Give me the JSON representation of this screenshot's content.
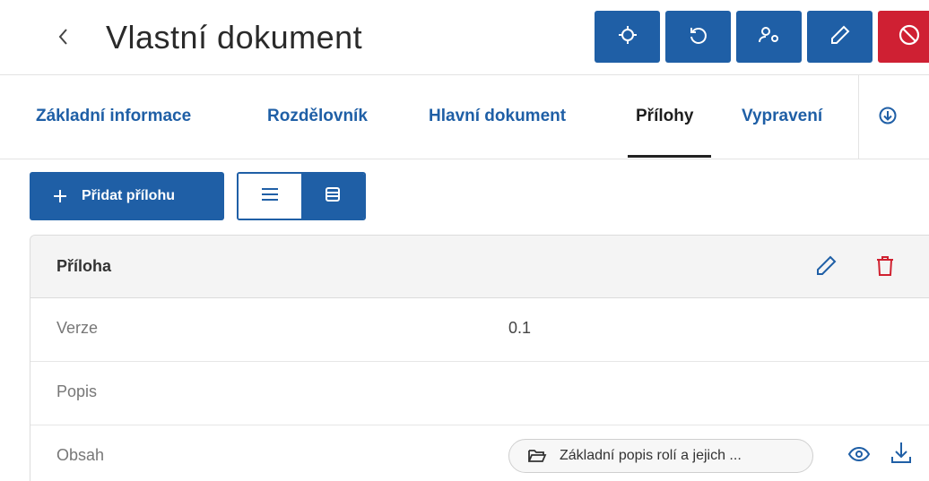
{
  "header": {
    "title": "Vlastní dokument",
    "back_icon": "chevron-left-icon",
    "toolbar": [
      {
        "icon": "crosshair-icon"
      },
      {
        "icon": "history-icon"
      },
      {
        "icon": "user-settings-icon"
      },
      {
        "icon": "pencil-icon"
      },
      {
        "icon": "block-icon"
      }
    ]
  },
  "tabs": [
    {
      "label": "Základní informace",
      "active": false
    },
    {
      "label": "Rozdělovník",
      "active": false
    },
    {
      "label": "Hlavní dokument",
      "active": false
    },
    {
      "label": "Přílohy",
      "active": true
    },
    {
      "label": "Vypravení",
      "active": false
    }
  ],
  "tabs_more_icon": "circle-arrow-down-icon",
  "actions": {
    "add_label": "Přidat přílohu",
    "view_modes": [
      "list",
      "table"
    ],
    "selected_view": "table"
  },
  "attachment": {
    "title": "Příloha",
    "rows": [
      {
        "label": "Verze",
        "value": "0.1"
      },
      {
        "label": "Popis",
        "value": ""
      },
      {
        "label": "Obsah",
        "file": "Základní popis rolí a jejich ..."
      }
    ]
  },
  "colors": {
    "primary": "#1f5fa6",
    "danger": "#cf2033",
    "danger_icon": "#d0202f"
  }
}
